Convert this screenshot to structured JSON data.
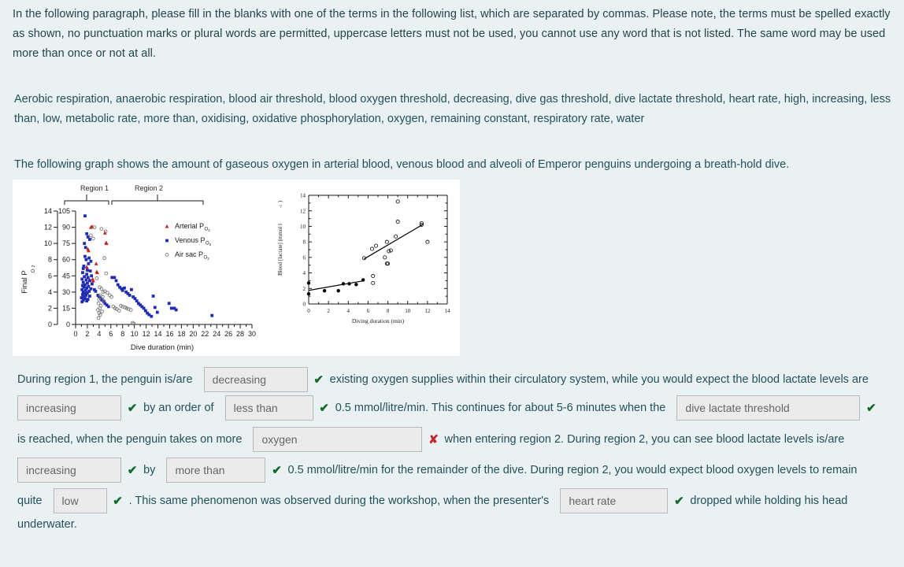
{
  "intro": "In the following paragraph, please fill in the blanks with one of the terms in the following list, which are separated by commas.  Please note, the terms must be spelled exactly as shown, no punctuation marks or plural words are permitted, uppercase letters must not be used, you cannot use any word that is not listed.  The same word may be used more than once or not at all.",
  "term_list": "Aerobic respiration, anaerobic respiration, blood air threshold, blood oxygen threshold, decreasing, dive gas threshold, dive lactate threshold, heart rate, high, increasing, less than, low, metabolic rate, more than, oxidising, oxidative phosphorylation, oxygen, remaining constant, respiratory rate, water",
  "graph_intro": "The following graph shows the amount of gaseous oxygen in arterial blood, venous blood and alveoli of Emperor penguins undergoing a breath-hold dive.",
  "figure": {
    "region1_label": "Region 1",
    "region2_label": "Region 2"
  },
  "sentences": {
    "s1a": "During region 1, the penguin is/are",
    "s1b": "existing oxygen supplies within their circulatory system, while you would expect the blood lactate levels are",
    "s2a": "by an order of",
    "s2b": "0.5 mmol/litre/min.  This continues for about 5-6 minutes when the",
    "s3a": "is reached, when the penguin takes on more",
    "s3b": "when entering region 2.  During region 2, you can see blood lactate levels is/are",
    "s4a": "by",
    "s4b": "0.5 mmol/litre/min for the remainder of the dive.  During region 2, you would expect blood oxygen levels to remain",
    "s5a": "quite",
    "s5b": ".  This same phenomenon was observed during the workshop, when the presenter's",
    "s5c": "dropped while holding his head",
    "s6": "underwater."
  },
  "answers": {
    "a1": "decreasing",
    "a2": "increasing",
    "a3": "less than",
    "a4": "dive lactate threshold",
    "a5": "oxygen",
    "a6": "increasing",
    "a7": "more than",
    "a8": "low",
    "a9": "heart rate"
  },
  "marks": {
    "m1": "✔",
    "m2": "✔",
    "m3": "✔",
    "m4": "✔",
    "m5": "✘",
    "m6": "✔",
    "m7": "✔",
    "m8": "✔",
    "m9": "✔"
  },
  "colors": {
    "page_bg": "#e9f1f3",
    "text": "#24505a",
    "blank_bg": "#ebebeb",
    "blank_border": "#b9b9b9",
    "correct": "#136b2b",
    "incorrect": "#c1272d",
    "arterial": "#cc2222",
    "venous": "#1f2bb5",
    "airsac": "#777777"
  },
  "chart_data": [
    {
      "type": "scatter",
      "title": "",
      "xlabel": "Dive duration (min)",
      "ylabel": "Final P_O2",
      "ylabel_right": "",
      "xlim": [
        0,
        30
      ],
      "ylim": [
        0,
        14
      ],
      "ylim_right": [
        0,
        105
      ],
      "xticks": [
        0,
        2,
        4,
        6,
        8,
        10,
        12,
        14,
        16,
        18,
        20,
        22,
        24,
        26,
        28,
        30
      ],
      "yticks": [
        0,
        2,
        4,
        6,
        8,
        10,
        12,
        14
      ],
      "yticks_right": [
        0,
        15,
        30,
        45,
        60,
        75,
        90,
        105
      ],
      "grid": false,
      "legend_position": "upper-right",
      "legend": [
        "Arterial P_O2",
        "Venous P_O2",
        "Air sac P_O2"
      ],
      "annotations": [
        "Region 1",
        "Region 2"
      ],
      "series": [
        {
          "name": "Arterial P_O2",
          "marker": "triangle",
          "color": "#cc2222",
          "points": [
            [
              2.6,
              12.0
            ],
            [
              2.8,
              12.1
            ],
            [
              5.0,
              11.3
            ],
            [
              5.2,
              10.1
            ],
            [
              5.25,
              10.0
            ],
            [
              2.1,
              9.3
            ],
            [
              2.2,
              9.1
            ],
            [
              3.5,
              7.5
            ],
            [
              3.6,
              6.5
            ],
            [
              3.7,
              6.4
            ],
            [
              2.9,
              5.6
            ],
            [
              3.0,
              5.4
            ],
            [
              2.4,
              5.5
            ],
            [
              2.0,
              6.8
            ],
            [
              1.9,
              7.1
            ]
          ]
        },
        {
          "name": "Venous P_O2",
          "marker": "square",
          "color": "#1f2bb5",
          "points": [
            [
              1.6,
              13.4
            ],
            [
              1.9,
              11.2
            ],
            [
              2.1,
              10.8
            ],
            [
              2.4,
              10.5
            ],
            [
              1.5,
              10.0
            ],
            [
              1.7,
              9.5
            ],
            [
              1.6,
              8.4
            ],
            [
              1.8,
              8.0
            ],
            [
              2.3,
              8.2
            ],
            [
              2.6,
              7.8
            ],
            [
              2.2,
              7.5
            ],
            [
              1.4,
              7.2
            ],
            [
              1.3,
              6.9
            ],
            [
              2.0,
              6.7
            ],
            [
              2.5,
              6.6
            ],
            [
              1.2,
              6.4
            ],
            [
              1.9,
              6.2
            ],
            [
              2.7,
              6.0
            ],
            [
              1.5,
              5.9
            ],
            [
              2.1,
              5.8
            ],
            [
              1.1,
              5.6
            ],
            [
              1.8,
              5.5
            ],
            [
              2.4,
              5.4
            ],
            [
              1.3,
              5.2
            ],
            [
              2.0,
              5.1
            ],
            [
              2.8,
              5.0
            ],
            [
              1.6,
              4.9
            ],
            [
              1.2,
              4.8
            ],
            [
              2.2,
              4.7
            ],
            [
              1.4,
              4.6
            ],
            [
              1.9,
              4.5
            ],
            [
              2.6,
              4.4
            ],
            [
              1.1,
              4.3
            ],
            [
              1.7,
              4.2
            ],
            [
              2.3,
              4.1
            ],
            [
              1.3,
              4.0
            ],
            [
              2.0,
              3.9
            ],
            [
              1.5,
              3.8
            ],
            [
              1.2,
              3.7
            ],
            [
              1.8,
              3.6
            ],
            [
              2.4,
              3.5
            ],
            [
              1.4,
              3.4
            ],
            [
              1.0,
              3.3
            ],
            [
              1.6,
              3.2
            ],
            [
              2.1,
              3.1
            ],
            [
              1.3,
              3.0
            ],
            [
              1.9,
              2.9
            ],
            [
              1.1,
              2.8
            ],
            [
              3.2,
              4.3
            ],
            [
              3.4,
              4.1
            ],
            [
              3.8,
              3.6
            ],
            [
              4.0,
              3.4
            ],
            [
              4.3,
              3.2
            ],
            [
              4.5,
              3.0
            ],
            [
              4.8,
              2.8
            ],
            [
              5.0,
              2.6
            ],
            [
              5.3,
              2.4
            ],
            [
              5.6,
              2.2
            ],
            [
              6.2,
              5.8
            ],
            [
              6.6,
              5.8
            ],
            [
              6.9,
              5.4
            ],
            [
              7.2,
              4.9
            ],
            [
              7.5,
              4.6
            ],
            [
              7.8,
              4.4
            ],
            [
              8.0,
              4.2
            ],
            [
              8.3,
              4.5
            ],
            [
              8.6,
              4.0
            ],
            [
              8.9,
              3.8
            ],
            [
              9.2,
              3.6
            ],
            [
              9.5,
              4.3
            ],
            [
              9.8,
              3.4
            ],
            [
              10.1,
              3.2
            ],
            [
              10.4,
              2.9
            ],
            [
              10.7,
              2.6
            ],
            [
              11.0,
              2.4
            ],
            [
              11.3,
              2.2
            ],
            [
              11.6,
              2.0
            ],
            [
              11.9,
              1.7
            ],
            [
              12.2,
              1.4
            ],
            [
              12.5,
              1.2
            ],
            [
              12.9,
              1.0
            ],
            [
              13.2,
              3.5
            ],
            [
              13.5,
              2.1
            ],
            [
              13.9,
              1.5
            ],
            [
              15.9,
              2.6
            ],
            [
              16.3,
              2.0
            ],
            [
              16.8,
              2.0
            ],
            [
              17.1,
              1.8
            ],
            [
              23.2,
              1.1
            ]
          ]
        },
        {
          "name": "Air sac P_O2",
          "marker": "circle",
          "color": "#777777",
          "points": [
            [
              3.2,
              12.0
            ],
            [
              4.4,
              11.8
            ],
            [
              5.1,
              11.5
            ],
            [
              2.6,
              11.0
            ],
            [
              3.0,
              10.6
            ],
            [
              4.9,
              8.2
            ],
            [
              5.2,
              6.3
            ],
            [
              3.6,
              5.7
            ],
            [
              4.1,
              4.6
            ],
            [
              4.4,
              4.4
            ],
            [
              4.2,
              3.6
            ],
            [
              4.6,
              3.4
            ],
            [
              4.0,
              3.1
            ],
            [
              4.8,
              2.9
            ],
            [
              3.9,
              2.6
            ],
            [
              4.3,
              2.3
            ],
            [
              4.1,
              2.0
            ],
            [
              3.8,
              1.8
            ],
            [
              4.5,
              1.6
            ],
            [
              4.0,
              1.4
            ],
            [
              4.2,
              1.2
            ],
            [
              3.9,
              0.8
            ],
            [
              5.4,
              3.9
            ],
            [
              5.8,
              3.6
            ],
            [
              6.1,
              3.4
            ],
            [
              6.4,
              2.2
            ],
            [
              6.7,
              2.0
            ],
            [
              7.0,
              1.9
            ],
            [
              7.4,
              1.7
            ],
            [
              7.7,
              2.3
            ],
            [
              8.0,
              2.2
            ],
            [
              8.4,
              2.1
            ],
            [
              8.7,
              2.0
            ],
            [
              9.0,
              1.9
            ],
            [
              9.4,
              1.8
            ],
            [
              9.7,
              0.2
            ],
            [
              9.9,
              0.1
            ],
            [
              5.0,
              4.1
            ],
            [
              4.7,
              4.0
            ]
          ]
        }
      ]
    },
    {
      "type": "scatter",
      "title": "",
      "xlabel": "Diving duration (min)",
      "ylabel": "Blood [lactate] (mmol l-1)",
      "xlim": [
        0,
        14
      ],
      "ylim": [
        0,
        14
      ],
      "xticks": [
        0,
        2,
        4,
        6,
        8,
        10,
        12,
        14
      ],
      "yticks": [
        0,
        2,
        4,
        6,
        8,
        10,
        12,
        14
      ],
      "grid": false,
      "legend_position": "none",
      "series": [
        {
          "name": "filled",
          "marker": "filled-circle",
          "color": "#000000",
          "points": [
            [
              0.0,
              2.7
            ],
            [
              0.0,
              1.3
            ],
            [
              1.6,
              1.7
            ],
            [
              3.0,
              1.7
            ],
            [
              3.5,
              2.6
            ],
            [
              4.1,
              2.6
            ],
            [
              4.8,
              2.5
            ],
            [
              5.5,
              3.1
            ]
          ]
        },
        {
          "name": "open",
          "marker": "open",
          "color": "#000000",
          "points": [
            [
              5.6,
              5.9
            ],
            [
              6.4,
              7.1
            ],
            [
              6.8,
              7.5
            ],
            [
              6.5,
              3.6
            ],
            [
              6.5,
              2.7
            ],
            [
              7.7,
              6.0
            ],
            [
              7.9,
              5.2
            ],
            [
              8.0,
              5.2
            ],
            [
              8.1,
              6.8
            ],
            [
              7.9,
              8.0
            ],
            [
              8.3,
              6.9
            ],
            [
              8.8,
              8.7
            ],
            [
              9.0,
              13.2
            ],
            [
              9.0,
              10.6
            ],
            [
              11.4,
              10.4
            ],
            [
              11.4,
              10.2
            ],
            [
              12.0,
              8.0
            ]
          ]
        }
      ],
      "trendlines": [
        {
          "x": [
            0,
            5.6
          ],
          "y": [
            1.75,
            3.0
          ]
        },
        {
          "x": [
            5.6,
            11.6
          ],
          "y": [
            5.8,
            10.3
          ]
        }
      ]
    }
  ]
}
